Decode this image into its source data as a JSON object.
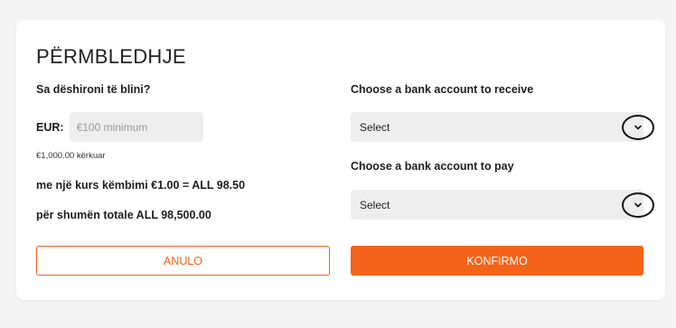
{
  "card": {
    "title": "PËRMBLEDHJE"
  },
  "purchase": {
    "question": "Sa dëshironi të blini?",
    "currency_label": "EUR:",
    "amount_value": "",
    "amount_placeholder": "€100 minimum",
    "required_hint": "€1,000.00 kërkuar",
    "rate_text": "me një kurs këmbimi €1.00 = ALL 98.50",
    "total_text": "për shumën totale ALL 98,500.00"
  },
  "receive_account": {
    "label": "Choose a bank account to receive",
    "selected": "Select"
  },
  "pay_account": {
    "label": "Choose a bank account to pay",
    "selected": "Select"
  },
  "actions": {
    "cancel_label": "ANULO",
    "confirm_label": "KONFIRMO"
  },
  "colors": {
    "accent": "#f5631a",
    "page_background": "#f4f4f4",
    "card_background": "#ffffff",
    "field_background": "#eeeeee"
  },
  "icons": {
    "dropdown": "chevron-down-icon"
  }
}
